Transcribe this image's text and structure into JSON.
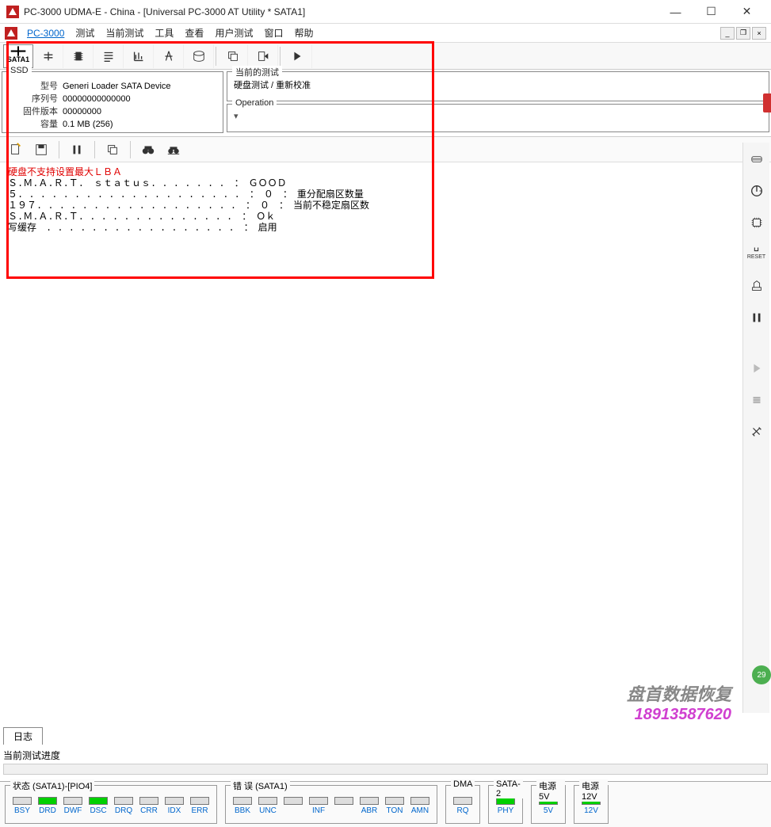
{
  "window": {
    "title": "PC-3000 UDMA-E - China - [Universal PC-3000 AT Utility * SATA1]"
  },
  "menu": {
    "pc3000": "PC-3000",
    "items": [
      "测试",
      "当前测试",
      "工具",
      "查看",
      "用户测试",
      "窗口",
      "帮助"
    ]
  },
  "toolbar_sata": "SATA1",
  "ssd_panel": {
    "title": "SSD",
    "model_lbl": "型号",
    "model": "Generi Loader SATA Device",
    "serial_lbl": "序列号",
    "serial": "00000000000000",
    "fw_lbl": "固件版本",
    "fw": "00000000",
    "cap_lbl": "容量",
    "cap": "0.1 MB (256)"
  },
  "current_test": {
    "title": "当前的测试",
    "value": "硬盘测试 / 重新校准"
  },
  "operation": {
    "title": "Operation",
    "value": "▾"
  },
  "log": {
    "err_line": "硬盘不支持设置最大ＬＢＡ",
    "l1": "Ｓ.Ｍ.Ａ.Ｒ.Ｔ.　ｓｔａｔｕｓ. . . . . . .　：　ＧＯＯＤ",
    "l2": "５. . . . . . . . . . . . . . . . . . . .　：　０　：　重分配扇区数量",
    "l3": "１９７. . . . . . . . . . . . . . . . . .　：　０　：　当前不稳定扇区数",
    "l4": "Ｓ.Ｍ.Ａ.Ｒ.Ｔ. . . . . . . . . . . . . .　：　Ｏｋ",
    "l5": "写缓存　. . . . . . . . . . . . . . . . .　：　启用"
  },
  "tabs": {
    "log": "日志"
  },
  "progress_label": "当前测试进度",
  "watermark": {
    "line1": "盘首数据恢复",
    "line2": "18913587620"
  },
  "badge": "29",
  "status": {
    "group1_title": "状态 (SATA1)-[PIO4]",
    "group1": [
      {
        "lbl": "BSY",
        "on": false
      },
      {
        "lbl": "DRD",
        "on": true
      },
      {
        "lbl": "DWF",
        "on": false
      },
      {
        "lbl": "DSC",
        "on": true
      },
      {
        "lbl": "DRQ",
        "on": false
      },
      {
        "lbl": "CRR",
        "on": false
      },
      {
        "lbl": "IDX",
        "on": false
      },
      {
        "lbl": "ERR",
        "on": false
      }
    ],
    "group2_title": "错 误 (SATA1)",
    "group2": [
      {
        "lbl": "BBK",
        "on": false
      },
      {
        "lbl": "UNC",
        "on": false
      },
      {
        "lbl": "",
        "on": false
      },
      {
        "lbl": "INF",
        "on": false
      },
      {
        "lbl": "",
        "on": false
      },
      {
        "lbl": "ABR",
        "on": false
      },
      {
        "lbl": "TON",
        "on": false
      },
      {
        "lbl": "AMN",
        "on": false
      }
    ],
    "dma_title": "DMA",
    "dma": [
      {
        "lbl": "RQ",
        "on": false
      }
    ],
    "sata2_title": "SATA-2",
    "sata2": [
      {
        "lbl": "PHY",
        "on": true
      }
    ],
    "pwr5_title": "电源 5V",
    "pwr5": [
      {
        "lbl": "5V",
        "on": true
      }
    ],
    "pwr12_title": "电源 12V",
    "pwr12": [
      {
        "lbl": "12V",
        "on": true
      }
    ]
  }
}
